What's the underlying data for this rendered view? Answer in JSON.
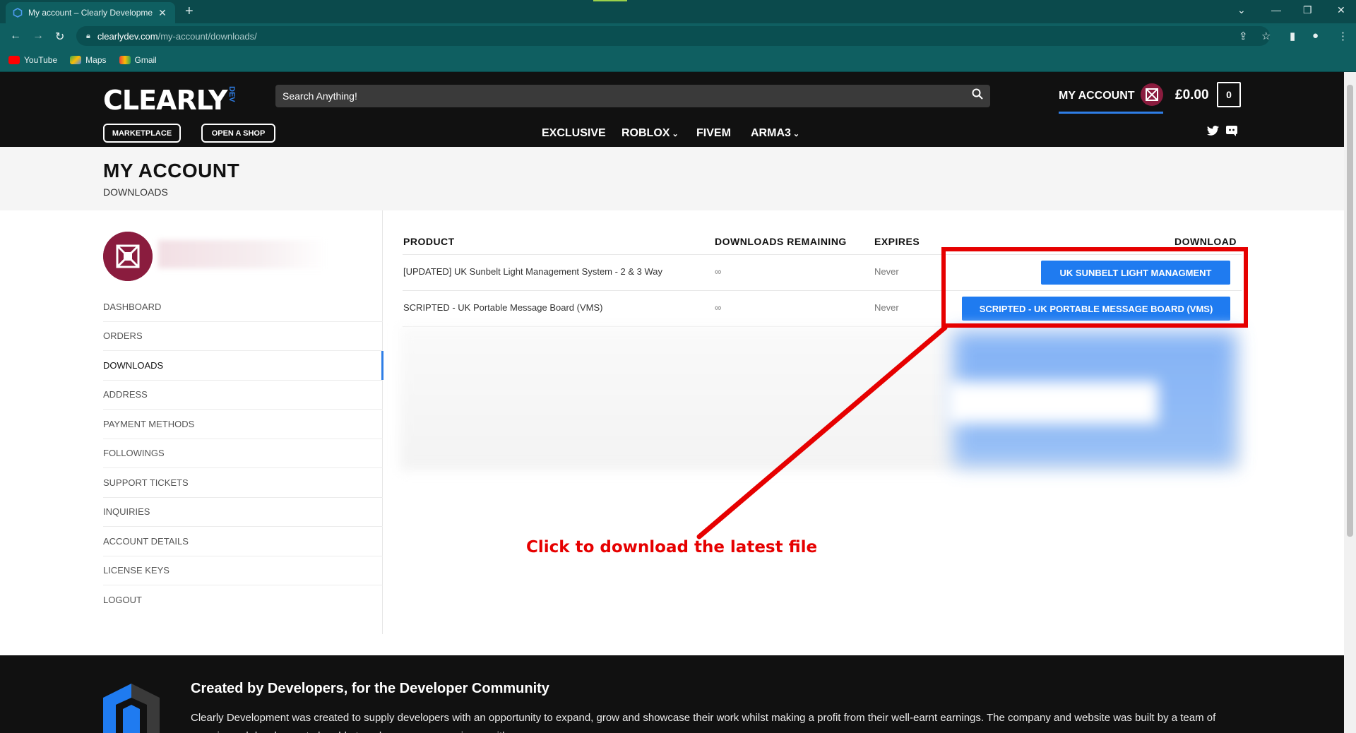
{
  "browser": {
    "tab_title": "My account – Clearly Developme",
    "new_tab": "+",
    "url_host": "clearlydev.com",
    "url_path": "/my-account/downloads/",
    "bookmarks": [
      "YouTube",
      "Maps",
      "Gmail"
    ]
  },
  "header": {
    "logo": "CLEARLY",
    "logo_sub": "DEV",
    "search_placeholder": "Search Anything!",
    "my_account": "MY ACCOUNT",
    "price": "£0.00",
    "cart_count": "0",
    "marketplace": "MARKETPLACE",
    "open_shop": "OPEN A SHOP",
    "nav": [
      "EXCLUSIVE",
      "ROBLOX",
      "FIVEM",
      "ARMA3"
    ]
  },
  "page": {
    "title": "MY ACCOUNT",
    "breadcrumb": "DOWNLOADS"
  },
  "sidebar": {
    "items": [
      "DASHBOARD",
      "ORDERS",
      "DOWNLOADS",
      "ADDRESS",
      "PAYMENT METHODS",
      "FOLLOWINGS",
      "SUPPORT TICKETS",
      "INQUIRIES",
      "ACCOUNT DETAILS",
      "LICENSE KEYS",
      "LOGOUT"
    ],
    "active": "DOWNLOADS"
  },
  "downloads": {
    "headers": [
      "PRODUCT",
      "DOWNLOADS REMAINING",
      "EXPIRES",
      "DOWNLOAD"
    ],
    "rows": [
      {
        "product": "[UPDATED] UK Sunbelt Light Management System - 2 & 3 Way",
        "remaining": "∞",
        "expires": "Never",
        "button": "UK SUNBELT LIGHT MANAGMENT"
      },
      {
        "product": "SCRIPTED - UK Portable Message Board (VMS)",
        "remaining": "∞",
        "expires": "Never",
        "button": "SCRIPTED - UK PORTABLE MESSAGE BOARD (VMS)"
      }
    ]
  },
  "annotation": {
    "text": "Click to download the latest file",
    "color": "#e60000"
  },
  "footer": {
    "title": "Created by Developers, for the Developer Community",
    "text": "Clearly Development was created to supply developers with an opportunity to expand, grow and showcase their work whilst making a profit from their well-earnt earnings. The company and website was built by a team of experienced developers to be able to enhance your experience with us."
  },
  "colors": {
    "accent": "#1f7bf0",
    "chrome": "#0f5f61",
    "header_bg": "#111111",
    "avatar": "#8a1c3e"
  }
}
